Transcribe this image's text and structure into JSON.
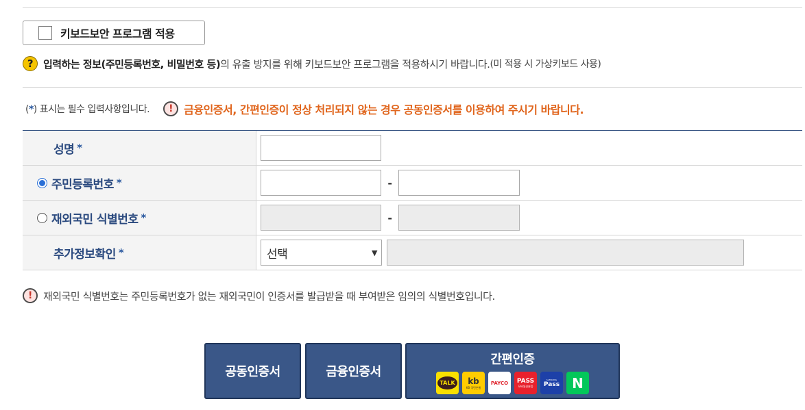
{
  "keyboard_security": {
    "label": "키보드보안 프로그램 적용"
  },
  "security_notice": {
    "icon": "question-icon",
    "bold_text": "입력하는 정보(주민등록번호, 비밀번호 등)",
    "text": "의 유출 방지를 위해 키보드보안 프로그램을 적용하시기 바랍니다.",
    "small_text": "(미 적용 시 가상키보드 사용)"
  },
  "required_note": {
    "open": "(",
    "star": "*",
    "text": ") 표시는 필수 입력사항입니다."
  },
  "warning": {
    "icon": "exclamation-icon",
    "text": "금융인증서, 간편인증이 정상 처리되지 않는 경우 공동인증서를 이용하여 주시기 바랍니다."
  },
  "form": {
    "required_star": "*",
    "name_label": "성명",
    "rrn_label": "주민등록번호",
    "foreigner_label": "재외국민 식별번호",
    "extra_label": "추가정보확인",
    "dash": "-",
    "extra_select_value": "선택",
    "select_arrow": "▼"
  },
  "bottom_note": {
    "text": "재외국민 식별번호는 주민등록번호가 없는 재외국민이 인증서를 발급받을 때 부여받은 임의의 식별번호입니다."
  },
  "buttons": {
    "joint_cert": "공동인증서",
    "financial_cert": "금융인증서",
    "simple_auth": "간편인증",
    "icons": {
      "kakao": "TALK",
      "kb": "kb",
      "kb_sub": "KB 국민은행",
      "payco": "PAYCO",
      "pass": "PASS",
      "pass_sub": "모바일신분증",
      "samsung_top": "SAMSUNG",
      "samsung": "Pass",
      "naver": "N"
    }
  },
  "colors": {
    "accent": "#3a5788",
    "warning": "#e0641b",
    "label": "#2b4a7f"
  }
}
